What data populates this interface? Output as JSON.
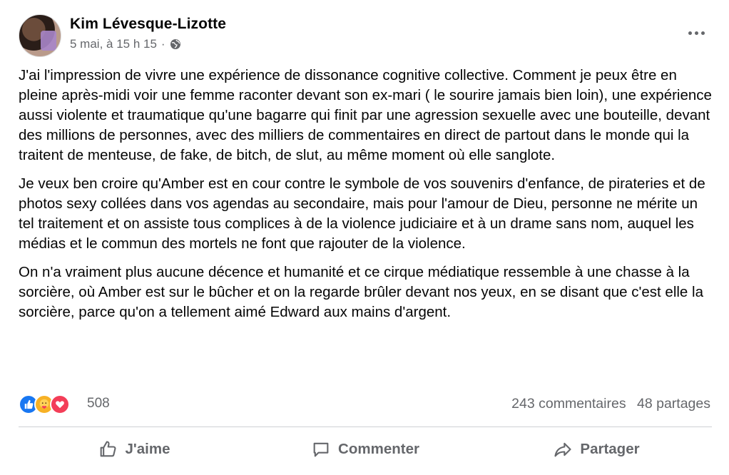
{
  "post": {
    "author": "Kim Lévesque-Lizotte",
    "timestamp": "5 mai, à 15 h 15",
    "separator": "·",
    "privacy_icon": "globe-icon",
    "paragraphs": [
      "J'ai l'impression de vivre une expérience de dissonance cognitive collective. Comment je peux être en pleine après-midi voir une femme raconter devant son ex-mari ( le sourire jamais bien loin), une expérience aussi violente et traumatique qu'une bagarre qui finit par une agression sexuelle avec une bouteille, devant des millions de personnes, avec des milliers de commentaires en direct de partout dans le monde qui la traitent de menteuse, de fake, de bitch, de slut, au même moment où elle sanglote.",
      "Je veux ben croire qu'Amber est en cour contre le symbole de vos souvenirs d'enfance, de pirateries et de photos sexy collées dans vos agendas au secondaire, mais pour l'amour de Dieu, personne ne mérite un tel traitement et on assiste tous complices à de la violence judiciaire et à un drame sans nom, auquel les médias et le commun des mortels ne font que rajouter de la violence.",
      "On n'a vraiment plus aucune décence et humanité et ce cirque médiatique ressemble à une chasse à la sorcière, où Amber est sur le bûcher et on la regarde brûler devant nos yeux, en se disant que c'est elle la sorcière, parce qu'on a tellement aimé Edward aux mains d'argent."
    ],
    "reactions": {
      "icons": [
        "like-reaction-icon",
        "care-reaction-icon",
        "love-reaction-icon"
      ],
      "count": "508",
      "comments": "243 commentaires",
      "shares": "48 partages"
    },
    "actions": {
      "like": "J'aime",
      "comment": "Commenter",
      "share": "Partager"
    },
    "colors": {
      "like_blue": "#1877f2",
      "care_yellow": "#f7b125",
      "love_red": "#f33e58",
      "secondary_text": "#65676b"
    }
  }
}
